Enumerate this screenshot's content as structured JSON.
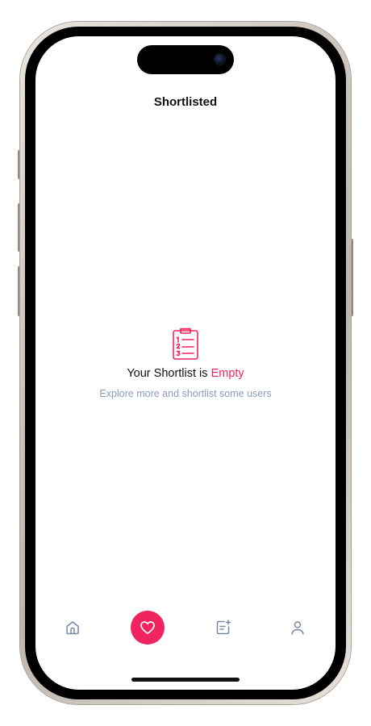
{
  "header": {
    "title": "Shortlisted"
  },
  "empty_state": {
    "icon": "clipboard-list-icon",
    "heading_prefix": "Your Shortlist is ",
    "heading_highlight": "Empty",
    "subtitle": "Explore more and shortlist some users"
  },
  "tabbar": {
    "active": "favorites",
    "items": [
      {
        "id": "home",
        "icon": "home-icon"
      },
      {
        "id": "favorites",
        "icon": "heart-icon"
      },
      {
        "id": "posts",
        "icon": "notes-add-icon"
      },
      {
        "id": "profile",
        "icon": "user-icon"
      }
    ]
  },
  "colors": {
    "accent": "#f0245e",
    "muted_text": "#8e9bb6",
    "inactive_icon": "#7a88a6",
    "text": "#111111",
    "background": "#ffffff"
  }
}
